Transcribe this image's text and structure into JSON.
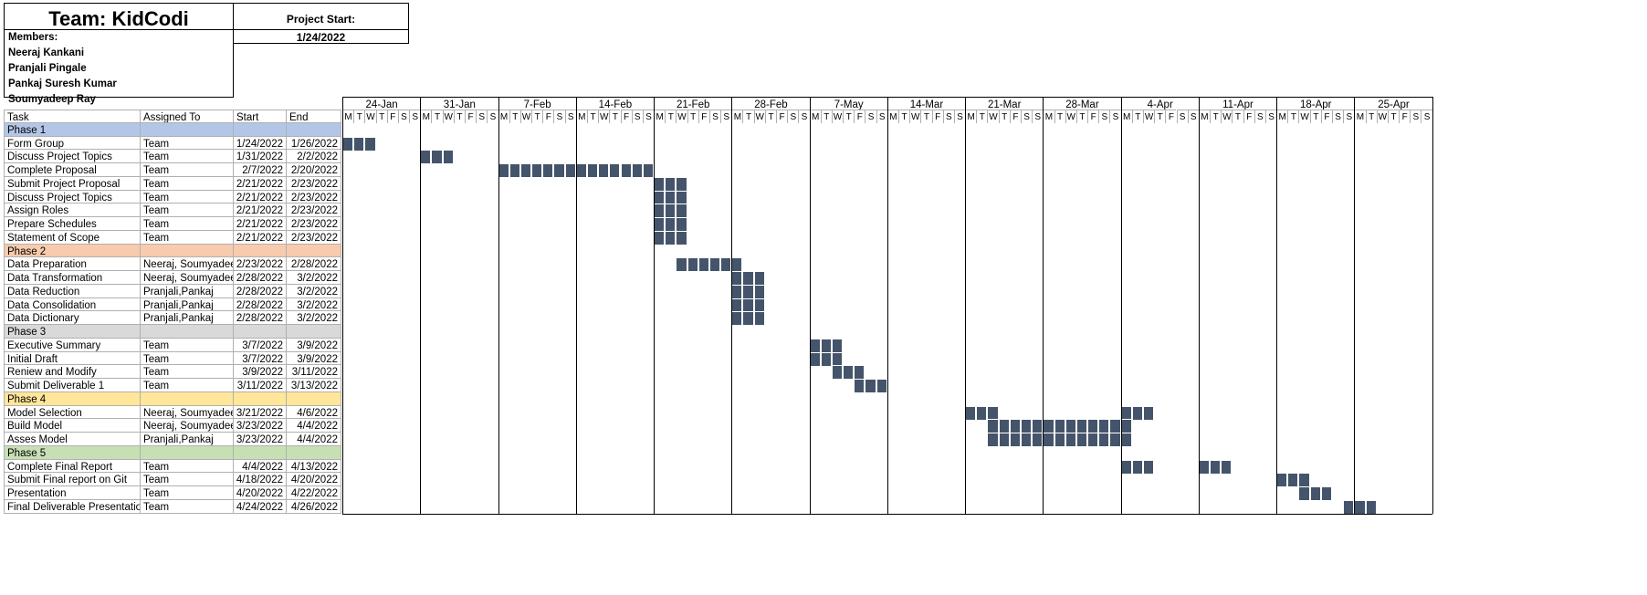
{
  "team": {
    "title": "Team: KidCodi"
  },
  "project": {
    "start_label": "Project Start:",
    "start_date": "1/24/2022"
  },
  "members": {
    "label": "Members:",
    "names": [
      "Neeraj Kankani",
      "Pranjali Pingale",
      "Pankaj Suresh Kumar",
      "Soumyadeep Ray"
    ]
  },
  "columns": {
    "task": "Task",
    "assigned": "Assigned To",
    "start": "Start",
    "end": "End"
  },
  "weeks": [
    "24-Jan",
    "31-Jan",
    "7-Feb",
    "14-Feb",
    "21-Feb",
    "28-Feb",
    "7-May",
    "14-Mar",
    "21-Mar",
    "28-Mar",
    "4-Apr",
    "11-Apr",
    "18-Apr",
    "25-Apr"
  ],
  "days": [
    "M",
    "T",
    "W",
    "T",
    "F",
    "S",
    "S"
  ],
  "colors": {
    "bar": "#44546a",
    "phase1": "#b4c6e7",
    "phase2": "#f8cbad",
    "phase3": "#d9d9d9",
    "phase4": "#ffe699",
    "phase5": "#c6e0b4"
  },
  "rows": [
    {
      "type": "phase",
      "task": "Phase 1",
      "color": "#b4c6e7"
    },
    {
      "type": "task",
      "task": "Form Group",
      "assigned": "Team",
      "start": "1/24/2022",
      "end": "1/26/2022",
      "s": 0,
      "e": 2
    },
    {
      "type": "task",
      "task": "Discuss Project Topics",
      "assigned": "Team",
      "start": "1/31/2022",
      "end": "2/2/2022",
      "s": 7,
      "e": 9
    },
    {
      "type": "task",
      "task": "Complete Proposal",
      "assigned": "Team",
      "start": "2/7/2022",
      "end": "2/20/2022",
      "s": 14,
      "e": 27
    },
    {
      "type": "task",
      "task": "Submit Project Proposal",
      "assigned": "Team",
      "start": "2/21/2022",
      "end": "2/23/2022",
      "s": 28,
      "e": 30
    },
    {
      "type": "task",
      "task": "Discuss Project Topics",
      "assigned": "Team",
      "start": "2/21/2022",
      "end": "2/23/2022",
      "s": 28,
      "e": 30
    },
    {
      "type": "task",
      "task": "Assign Roles",
      "assigned": "Team",
      "start": "2/21/2022",
      "end": "2/23/2022",
      "s": 28,
      "e": 30
    },
    {
      "type": "task",
      "task": "Prepare Schedules",
      "assigned": "Team",
      "start": "2/21/2022",
      "end": "2/23/2022",
      "s": 28,
      "e": 30
    },
    {
      "type": "task",
      "task": "Statement of Scope",
      "assigned": "Team",
      "start": "2/21/2022",
      "end": "2/23/2022",
      "s": 28,
      "e": 30
    },
    {
      "type": "phase",
      "task": "Phase 2",
      "color": "#f8cbad"
    },
    {
      "type": "task",
      "task": "Data Preparation",
      "assigned": "Neeraj, Soumyadeep",
      "start": "2/23/2022",
      "end": "2/28/2022",
      "s": 30,
      "e": 35
    },
    {
      "type": "task",
      "task": "Data Transformation",
      "assigned": "Neeraj, Soumyadeep",
      "start": "2/28/2022",
      "end": "3/2/2022",
      "s": 35,
      "e": 37
    },
    {
      "type": "task",
      "task": "Data Reduction",
      "assigned": "Pranjali,Pankaj",
      "start": "2/28/2022",
      "end": "3/2/2022",
      "s": 35,
      "e": 37
    },
    {
      "type": "task",
      "task": "Data Consolidation",
      "assigned": "Pranjali,Pankaj",
      "start": "2/28/2022",
      "end": "3/2/2022",
      "s": 35,
      "e": 37
    },
    {
      "type": "task",
      "task": "Data Dictionary",
      "assigned": "Pranjali,Pankaj",
      "start": "2/28/2022",
      "end": "3/2/2022",
      "s": 35,
      "e": 37
    },
    {
      "type": "phase",
      "task": "Phase 3",
      "color": "#d9d9d9"
    },
    {
      "type": "task",
      "task": "Executive Summary",
      "assigned": "Team",
      "start": "3/7/2022",
      "end": "3/9/2022",
      "s": 42,
      "e": 44
    },
    {
      "type": "task",
      "task": "Initial Draft",
      "assigned": "Team",
      "start": "3/7/2022",
      "end": "3/9/2022",
      "s": 42,
      "e": 44
    },
    {
      "type": "task",
      "task": "Reniew and Modify",
      "assigned": "Team",
      "start": "3/9/2022",
      "end": "3/11/2022",
      "s": 44,
      "e": 46
    },
    {
      "type": "task",
      "task": "Submit Deliverable 1",
      "assigned": "Team",
      "start": "3/11/2022",
      "end": "3/13/2022",
      "s": 46,
      "e": 48
    },
    {
      "type": "phase",
      "task": "Phase 4",
      "color": "#ffe699"
    },
    {
      "type": "task",
      "task": "Model Selection",
      "assigned": "Neeraj, Soumyadeep",
      "start": "3/21/2022",
      "end": "4/6/2022",
      "segments": [
        [
          56,
          58
        ],
        [
          70,
          72
        ]
      ]
    },
    {
      "type": "task",
      "task": "Build Model",
      "assigned": "Neeraj, Soumyadeep",
      "start": "3/23/2022",
      "end": "4/4/2022",
      "s": 58,
      "e": 70
    },
    {
      "type": "task",
      "task": "Asses Model",
      "assigned": "Pranjali,Pankaj",
      "start": "3/23/2022",
      "end": "4/4/2022",
      "s": 58,
      "e": 70
    },
    {
      "type": "phase",
      "task": "Phase 5",
      "color": "#c6e0b4"
    },
    {
      "type": "task",
      "task": "Complete Final Report",
      "assigned": "Team",
      "start": "4/4/2022",
      "end": "4/13/2022",
      "segments": [
        [
          70,
          72
        ],
        [
          77,
          79
        ]
      ]
    },
    {
      "type": "task",
      "task": "Submit Final report on Git",
      "assigned": "Team",
      "start": "4/18/2022",
      "end": "4/20/2022",
      "s": 84,
      "e": 86
    },
    {
      "type": "task",
      "task": "Presentation",
      "assigned": "Team",
      "start": "4/20/2022",
      "end": "4/22/2022",
      "s": 86,
      "e": 88
    },
    {
      "type": "task",
      "task": "Final Deliverable Presentation",
      "assigned": "Team",
      "start": "4/24/2022",
      "end": "4/26/2022",
      "s": 90,
      "e": 92
    }
  ]
}
